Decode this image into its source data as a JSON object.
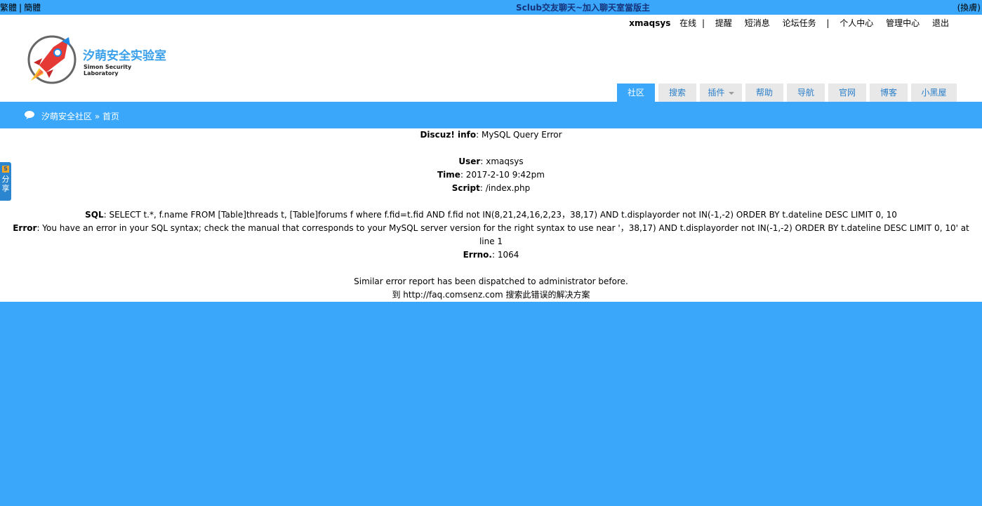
{
  "topbar": {
    "lang_traditional": "繁體",
    "lang_simplified": "簡體",
    "marquee": "Sclub交友聊天~加入聊天室當版主",
    "switch": "(換膚)"
  },
  "userbar": {
    "username": "xmaqsys",
    "status": "在线",
    "items": [
      "提醒",
      "短消息",
      "论坛任务",
      "个人中心",
      "管理中心",
      "退出"
    ]
  },
  "logo": {
    "title": "汐萌安全实验室",
    "subtitle": "Simon Security Laboratory"
  },
  "nav": {
    "tabs": [
      {
        "label": "社区",
        "active": true
      },
      {
        "label": "搜索"
      },
      {
        "label": "插件",
        "dropdown": true
      },
      {
        "label": "帮助"
      },
      {
        "label": "导航"
      },
      {
        "label": "官网"
      },
      {
        "label": "博客"
      },
      {
        "label": "小黑屋"
      }
    ]
  },
  "breadcrumb": {
    "home": "汐萌安全社区",
    "sep": "»",
    "current": "首页"
  },
  "error": {
    "head_label": "Discuz! info",
    "head_value": ": MySQL Query Error",
    "user_label": "User",
    "user_value": ": xmaqsys",
    "time_label": "Time",
    "time_value": ": 2017-2-10 9:42pm",
    "script_label": "Script",
    "script_value": ": /index.php",
    "sql_label": "SQL",
    "sql_value": ": SELECT t.*, f.name FROM [Table]threads t, [Table]forums f where f.fid=t.fid AND f.fid not IN(8,21,24,16,2,23，38,17) AND t.displayorder not IN(-1,-2) ORDER BY t.dateline DESC LIMIT 0, 10",
    "error_label": "Error",
    "error_value": ": You have an error in your SQL syntax; check the manual that corresponds to your MySQL server version for the right syntax to use near '，38,17) AND t.displayorder not IN(-1,-2) ORDER BY t.dateline DESC LIMIT 0, 10' at line 1",
    "errno_label": "Errno.",
    "errno_value": ": 1064",
    "dispatched": "Similar error report has been dispatched to administrator before.",
    "faq_prefix": "到 ",
    "faq_link": "http://faq.comsenz.com",
    "faq_suffix": " 搜索此错误的解决方案"
  },
  "share": {
    "icon": "S",
    "label1": "分",
    "label2": "享"
  },
  "colors": {
    "brand_blue": "#3aa7fb",
    "marquee": "#16337a",
    "tab_text": "#2a7fc9"
  }
}
